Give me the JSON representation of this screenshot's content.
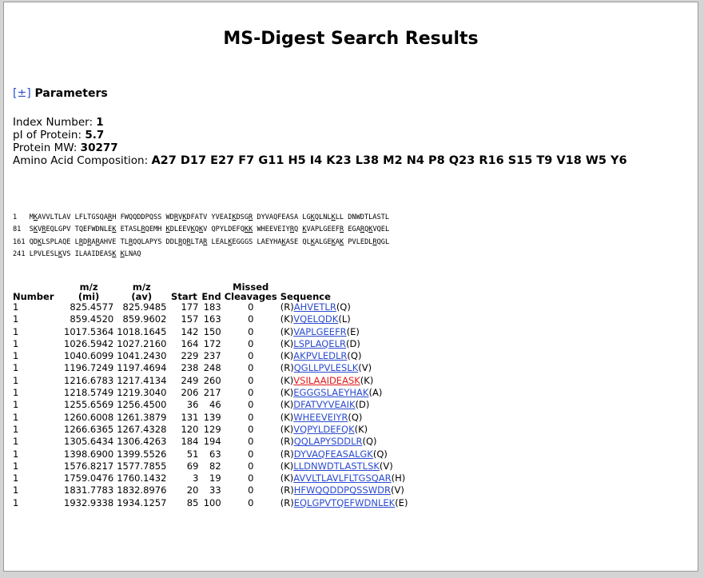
{
  "page": {
    "title": "MS-Digest Search Results"
  },
  "parameters": {
    "toggle": "[±]",
    "label": "Parameters"
  },
  "protein": {
    "index_label": "Index Number: ",
    "index_value": "1",
    "pi_label": "pI of Protein: ",
    "pi_value": "5.7",
    "mw_label": "Protein MW: ",
    "mw_value": "30277",
    "aa_label": "Amino Acid Composition: ",
    "aa_value": "A27 D17 E27 F7 G11 H5 I4 K23 L38 M2 N4 P8 Q23 R16 S15 T9 V18 W5 Y6"
  },
  "sequence_lines": [
    "1   M<u>K</u>AVVLTLAV LFLTGSQA<u>R</u>H FWQQDDPQSS WD<u>R</u>V<u>K</u>DFATV YVEAI<u>K</u>DSG<u>R</u> DYVAQFEASA LG<u>K</u>QLNL<u>K</u>LL DNWDTLASTL",
    "81  S<u>K</u>V<u>R</u>EQLGPV TQEFWDNLE<u>K</u> ETASL<u>R</u>QEMH <u>K</u>DLEEV<u>K</u>Q<u>K</u>V QPYLDEFQ<u>K</u><u>K</u> WHEEVEIY<u>R</u>Q <u>K</u>VAPLGEEF<u>R</u> EGA<u>R</u>Q<u>K</u>VQEL",
    "161 QD<u>K</u>LSPLAQE L<u>R</u>D<u>R</u>A<u>R</u>AHVE TL<u>R</u>QQLAPYS DDL<u>R</u>Q<u>R</u>LTA<u>R</u> LEAL<u>K</u>EGGGS LAEYHA<u>K</u>ASE QL<u>K</u>ALGE<u>K</u>A<u>K</u> PVLEDL<u>R</u>QGL",
    "241 LPVLESL<u>K</u>VS ILAAIDEAS<u>K</u> <u>K</u>LNAQ"
  ],
  "table": {
    "headers": {
      "number": "Number",
      "mz_mi": "m/z (mi)",
      "mz_av": "m/z (av)",
      "start": "Start",
      "end": "End",
      "missed": "Missed Cleavages",
      "sequence": "Sequence"
    },
    "rows": [
      {
        "number": "1",
        "mi": "825.4577",
        "av": "825.9485",
        "start": "177",
        "end": "183",
        "missed": "0",
        "pre": "(R)",
        "peptide": "AHVETLR",
        "post": "(Q)",
        "highlight": false
      },
      {
        "number": "1",
        "mi": "859.4520",
        "av": "859.9602",
        "start": "157",
        "end": "163",
        "missed": "0",
        "pre": "(K)",
        "peptide": "VQELQDK",
        "post": "(L)",
        "highlight": false
      },
      {
        "number": "1",
        "mi": "1017.5364",
        "av": "1018.1645",
        "start": "142",
        "end": "150",
        "missed": "0",
        "pre": "(K)",
        "peptide": "VAPLGEEFR",
        "post": "(E)",
        "highlight": false
      },
      {
        "number": "1",
        "mi": "1026.5942",
        "av": "1027.2160",
        "start": "164",
        "end": "172",
        "missed": "0",
        "pre": "(K)",
        "peptide": "LSPLAQELR",
        "post": "(D)",
        "highlight": false
      },
      {
        "number": "1",
        "mi": "1040.6099",
        "av": "1041.2430",
        "start": "229",
        "end": "237",
        "missed": "0",
        "pre": "(K)",
        "peptide": "AKPVLEDLR",
        "post": "(Q)",
        "highlight": false
      },
      {
        "number": "1",
        "mi": "1196.7249",
        "av": "1197.4694",
        "start": "238",
        "end": "248",
        "missed": "0",
        "pre": "(R)",
        "peptide": "QGLLPVLESLK",
        "post": "(V)",
        "highlight": false
      },
      {
        "number": "1",
        "mi": "1216.6783",
        "av": "1217.4134",
        "start": "249",
        "end": "260",
        "missed": "0",
        "pre": "(K)",
        "peptide": "VSILAAIDEASK",
        "post": "(K)",
        "highlight": true
      },
      {
        "number": "1",
        "mi": "1218.5749",
        "av": "1219.3040",
        "start": "206",
        "end": "217",
        "missed": "0",
        "pre": "(K)",
        "peptide": "EGGGSLAEYHAK",
        "post": "(A)",
        "highlight": false
      },
      {
        "number": "1",
        "mi": "1255.6569",
        "av": "1256.4500",
        "start": "36",
        "end": "46",
        "missed": "0",
        "pre": "(K)",
        "peptide": "DFATVYVEAIK",
        "post": "(D)",
        "highlight": false
      },
      {
        "number": "1",
        "mi": "1260.6008",
        "av": "1261.3879",
        "start": "131",
        "end": "139",
        "missed": "0",
        "pre": "(K)",
        "peptide": "WHEEVEIYR",
        "post": "(Q)",
        "highlight": false
      },
      {
        "number": "1",
        "mi": "1266.6365",
        "av": "1267.4328",
        "start": "120",
        "end": "129",
        "missed": "0",
        "pre": "(K)",
        "peptide": "VQPYLDEFQK",
        "post": "(K)",
        "highlight": false
      },
      {
        "number": "1",
        "mi": "1305.6434",
        "av": "1306.4263",
        "start": "184",
        "end": "194",
        "missed": "0",
        "pre": "(R)",
        "peptide": "QQLAPYSDDLR",
        "post": "(Q)",
        "highlight": false
      },
      {
        "number": "1",
        "mi": "1398.6900",
        "av": "1399.5526",
        "start": "51",
        "end": "63",
        "missed": "0",
        "pre": "(R)",
        "peptide": "DYVAQFEASALGK",
        "post": "(Q)",
        "highlight": false
      },
      {
        "number": "1",
        "mi": "1576.8217",
        "av": "1577.7855",
        "start": "69",
        "end": "82",
        "missed": "0",
        "pre": "(K)",
        "peptide": "LLDNWDTLASTLSK",
        "post": "(V)",
        "highlight": false
      },
      {
        "number": "1",
        "mi": "1759.0476",
        "av": "1760.1432",
        "start": "3",
        "end": "19",
        "missed": "0",
        "pre": "(K)",
        "peptide": "AVVLTLAVLFLTGSQAR",
        "post": "(H)",
        "highlight": false
      },
      {
        "number": "1",
        "mi": "1831.7783",
        "av": "1832.8976",
        "start": "20",
        "end": "33",
        "missed": "0",
        "pre": "(R)",
        "peptide": "HFWQQDDPQSSWDR",
        "post": "(V)",
        "highlight": false
      },
      {
        "number": "1",
        "mi": "1932.9338",
        "av": "1934.1257",
        "start": "85",
        "end": "100",
        "missed": "0",
        "pre": "(R)",
        "peptide": "EQLGPVTQEFWDNLEK",
        "post": "(E)",
        "highlight": false
      }
    ]
  },
  "colors": {
    "link": "#2b4bd0",
    "highlight": "#e01a1a",
    "frame_bg": "#d4d4d4"
  }
}
